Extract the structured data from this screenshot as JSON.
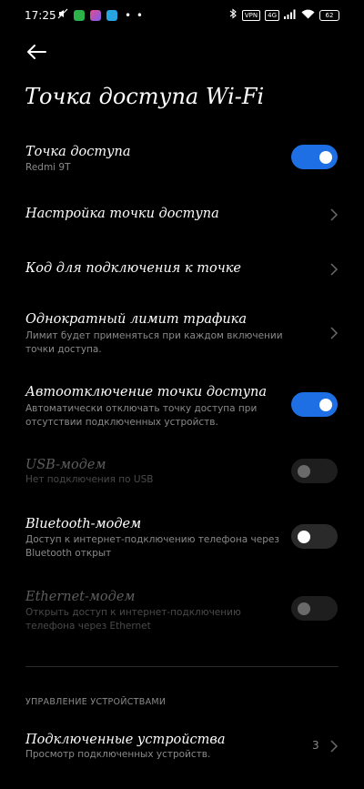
{
  "statusbar": {
    "time": "17:25",
    "dots": "• •",
    "vpn": "VPN",
    "lte": "4G",
    "battery": "62"
  },
  "page": {
    "title": "Точка доступа Wi-Fi"
  },
  "rows": [
    {
      "title": "Точка доступа",
      "subtitle": "Redmi 9T",
      "toggle": true
    },
    {
      "title": "Настройка точки доступа"
    },
    {
      "title": "Код для подключения к точке"
    },
    {
      "title": "Однократный лимит трафика",
      "subtitle": "Лимит будет применяться при каждом включении точки доступа."
    },
    {
      "title": "Автоотключение точки доступа",
      "subtitle": "Автоматически отключать точку доступа при отсутствии подключенных устройств.",
      "toggle": true
    },
    {
      "title": "USB-модем",
      "subtitle": "Нет подключения по USB",
      "toggle": false,
      "disabled": true
    },
    {
      "title": "Bluetooth-модем",
      "subtitle": "Доступ к интернет-подключению телефона через Bluetooth открыт",
      "toggle": false
    },
    {
      "title": "Ethernet-модем",
      "subtitle": "Открыть доступ к интернет-подключению телефона через Ethernet",
      "toggle": false,
      "disabled": true
    }
  ],
  "section": {
    "header": "Управление устройствами"
  },
  "devices": {
    "title": "Подключенные устройства",
    "subtitle": "Просмотр подключенных устройств.",
    "count": "3"
  },
  "colors": {
    "accent": "#1f6fe4",
    "background": "#000000",
    "muted": "#8a8a8a"
  }
}
